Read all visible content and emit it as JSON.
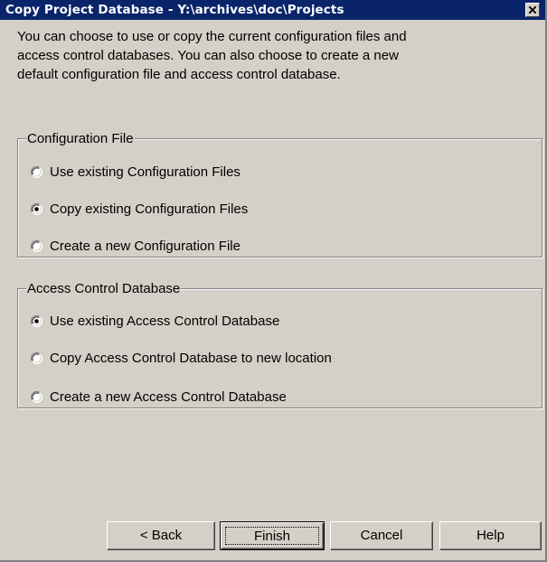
{
  "dialog": {
    "title": "Copy Project Database - Y:\\archives\\doc\\Projects",
    "intro_line1": "You can choose to use or copy the current configuration files and",
    "intro_line2": "access control databases. You can also choose to create a new",
    "intro_line3": "default configuration file and access control database."
  },
  "config_group": {
    "legend": "Configuration File",
    "options": [
      {
        "label": "Use existing Configuration Files",
        "selected": false
      },
      {
        "label": "Copy existing Configuration Files",
        "selected": true
      },
      {
        "label": "Create a new Configuration File",
        "selected": false
      }
    ]
  },
  "access_group": {
    "legend": "Access Control Database",
    "options": [
      {
        "label": "Use existing Access Control Database",
        "selected": true
      },
      {
        "label": "Copy Access Control Database to new location",
        "selected": false
      },
      {
        "label": "Create a new Access Control Database",
        "selected": false
      }
    ]
  },
  "buttons": {
    "back": "< Back",
    "finish": "Finish",
    "cancel": "Cancel",
    "help": "Help"
  },
  "icons": {
    "close": "close-icon",
    "radio_on": "radio-selected-icon",
    "radio_off": "radio-unselected-icon"
  },
  "colors": {
    "titlebar": "#0a246a",
    "face": "#d4d0c8"
  }
}
